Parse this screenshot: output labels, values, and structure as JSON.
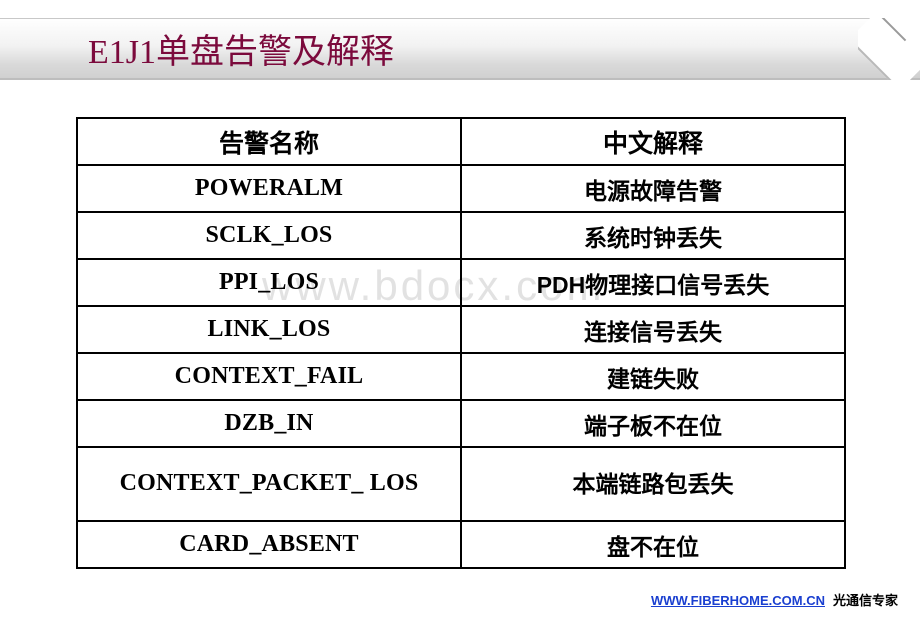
{
  "slide": {
    "title": "E1J1单盘告警及解释",
    "watermark": "www.bdocx.com"
  },
  "table": {
    "headers": [
      "告警名称",
      "中文解释"
    ],
    "rows": [
      {
        "name": "POWERALM",
        "desc": "电源故障告警",
        "tall": false
      },
      {
        "name": "SCLK_LOS",
        "desc": "系统时钟丢失",
        "tall": false
      },
      {
        "name": "PPI_LOS",
        "desc": "PDH物理接口信号丢失",
        "tall": false
      },
      {
        "name": "LINK_LOS",
        "desc": "连接信号丢失",
        "tall": false
      },
      {
        "name": "CONTEXT_FAIL",
        "desc": "建链失败",
        "tall": false
      },
      {
        "name": "DZB_IN",
        "desc": "端子板不在位",
        "tall": false
      },
      {
        "name": "CONTEXT_PACKET_ LOS",
        "desc": "本端链路包丢失",
        "tall": true
      },
      {
        "name": "CARD_ABSENT",
        "desc": "盘不在位",
        "tall": false
      }
    ]
  },
  "footer": {
    "url": "WWW.FIBERHOME.COM.CN",
    "slogan": "光通信专家"
  },
  "colors": {
    "title": "#7b0a3c",
    "link": "#1a3fd0",
    "border": "#000000",
    "watermark": "#e2e2e2"
  }
}
